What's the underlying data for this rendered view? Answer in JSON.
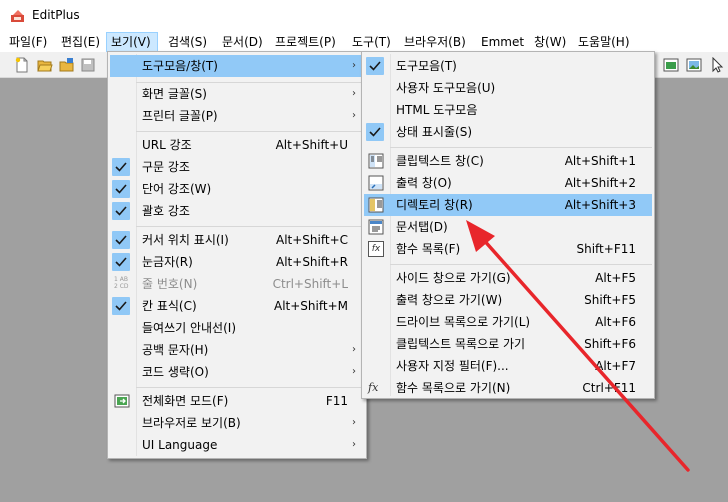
{
  "app": {
    "title": "EditPlus",
    "icon": "editplus-app-icon"
  },
  "menubar": {
    "items": [
      {
        "label": "파일(F)"
      },
      {
        "label": "편집(E)"
      },
      {
        "label": "보기(V)"
      },
      {
        "label": "검색(S)"
      },
      {
        "label": "문서(D)"
      },
      {
        "label": "프로젝트(P)"
      },
      {
        "label": "도구(T)"
      },
      {
        "label": "브라우저(B)"
      },
      {
        "label": "Emmet"
      },
      {
        "label": "창(W)"
      },
      {
        "label": "도움말(H)"
      }
    ]
  },
  "view_menu": {
    "items": [
      {
        "label": "도구모음/창(T)",
        "arrow": "›"
      },
      {
        "label": "화면 글꼴(S)",
        "arrow": "›"
      },
      {
        "label": "프린터 글꼴(P)",
        "arrow": "›"
      },
      {
        "label": "URL 강조",
        "shortcut": "Alt+Shift+U"
      },
      {
        "label": "구문 강조",
        "checked": true
      },
      {
        "label": "단어 강조(W)",
        "checked": true
      },
      {
        "label": "괄호 강조",
        "checked": true
      },
      {
        "label": "커서 위치 표시(I)",
        "shortcut": "Alt+Shift+C",
        "checked": true
      },
      {
        "label": "눈금자(R)",
        "shortcut": "Alt+Shift+R",
        "checked": true
      },
      {
        "label": "줄 번호(N)",
        "shortcut": "Ctrl+Shift+L",
        "disabled": true,
        "icon": "line-number-icon",
        "icon_text": "1 AB\n2 CD"
      },
      {
        "label": "칸 표식(C)",
        "shortcut": "Alt+Shift+M",
        "checked": true
      },
      {
        "label": "들여쓰기 안내선(I)"
      },
      {
        "label": "공백 문자(H)",
        "arrow": "›"
      },
      {
        "label": "코드 생략(O)",
        "arrow": "›"
      },
      {
        "label": "전체화면 모드(F)",
        "shortcut": "F11",
        "icon": "fullscreen-icon"
      },
      {
        "label": "브라우저로 보기(B)",
        "arrow": "›"
      },
      {
        "label": "UI Language",
        "arrow": "›"
      }
    ]
  },
  "toolbar_submenu": {
    "items": [
      {
        "label": "도구모음(T)",
        "checked": true
      },
      {
        "label": "사용자 도구모음(U)"
      },
      {
        "label": "HTML 도구모음"
      },
      {
        "label": "상태 표시줄(S)",
        "checked": true
      },
      {
        "label": "클립텍스트 창(C)",
        "shortcut": "Alt+Shift+1",
        "icon": "cliptext-window-icon"
      },
      {
        "label": "출력 창(O)",
        "shortcut": "Alt+Shift+2",
        "icon": "output-window-icon"
      },
      {
        "label": "디렉토리 창(R)",
        "shortcut": "Alt+Shift+3",
        "icon": "directory-window-icon"
      },
      {
        "label": "문서탭(D)",
        "icon": "document-tab-icon"
      },
      {
        "label": "함수 목록(F)",
        "shortcut": "Shift+F11",
        "icon": "function-list-icon",
        "icon_text": "fx"
      },
      {
        "label": "사이드 창으로 가기(G)",
        "shortcut": "Alt+F5"
      },
      {
        "label": "출력 창으로 가기(W)",
        "shortcut": "Shift+F5"
      },
      {
        "label": "드라이브 목록으로 가기(L)",
        "shortcut": "Alt+F6"
      },
      {
        "label": "클립텍스트 목록으로 가기",
        "shortcut": "Shift+F6"
      },
      {
        "label": "사용자 지정 필터(F)...",
        "shortcut": "Alt+F7"
      },
      {
        "label": "함수 목록으로 가기(N)",
        "shortcut": "Ctrl+F11",
        "icon": "goto-function-list-icon",
        "icon_text": "fx"
      }
    ]
  },
  "colors": {
    "highlight": "#91c9f7",
    "check_bg": "#90c8f6",
    "menu_bg": "#f2f2f2",
    "workspace": "#a0a0a0",
    "annotation_arrow": "#e8262b"
  }
}
